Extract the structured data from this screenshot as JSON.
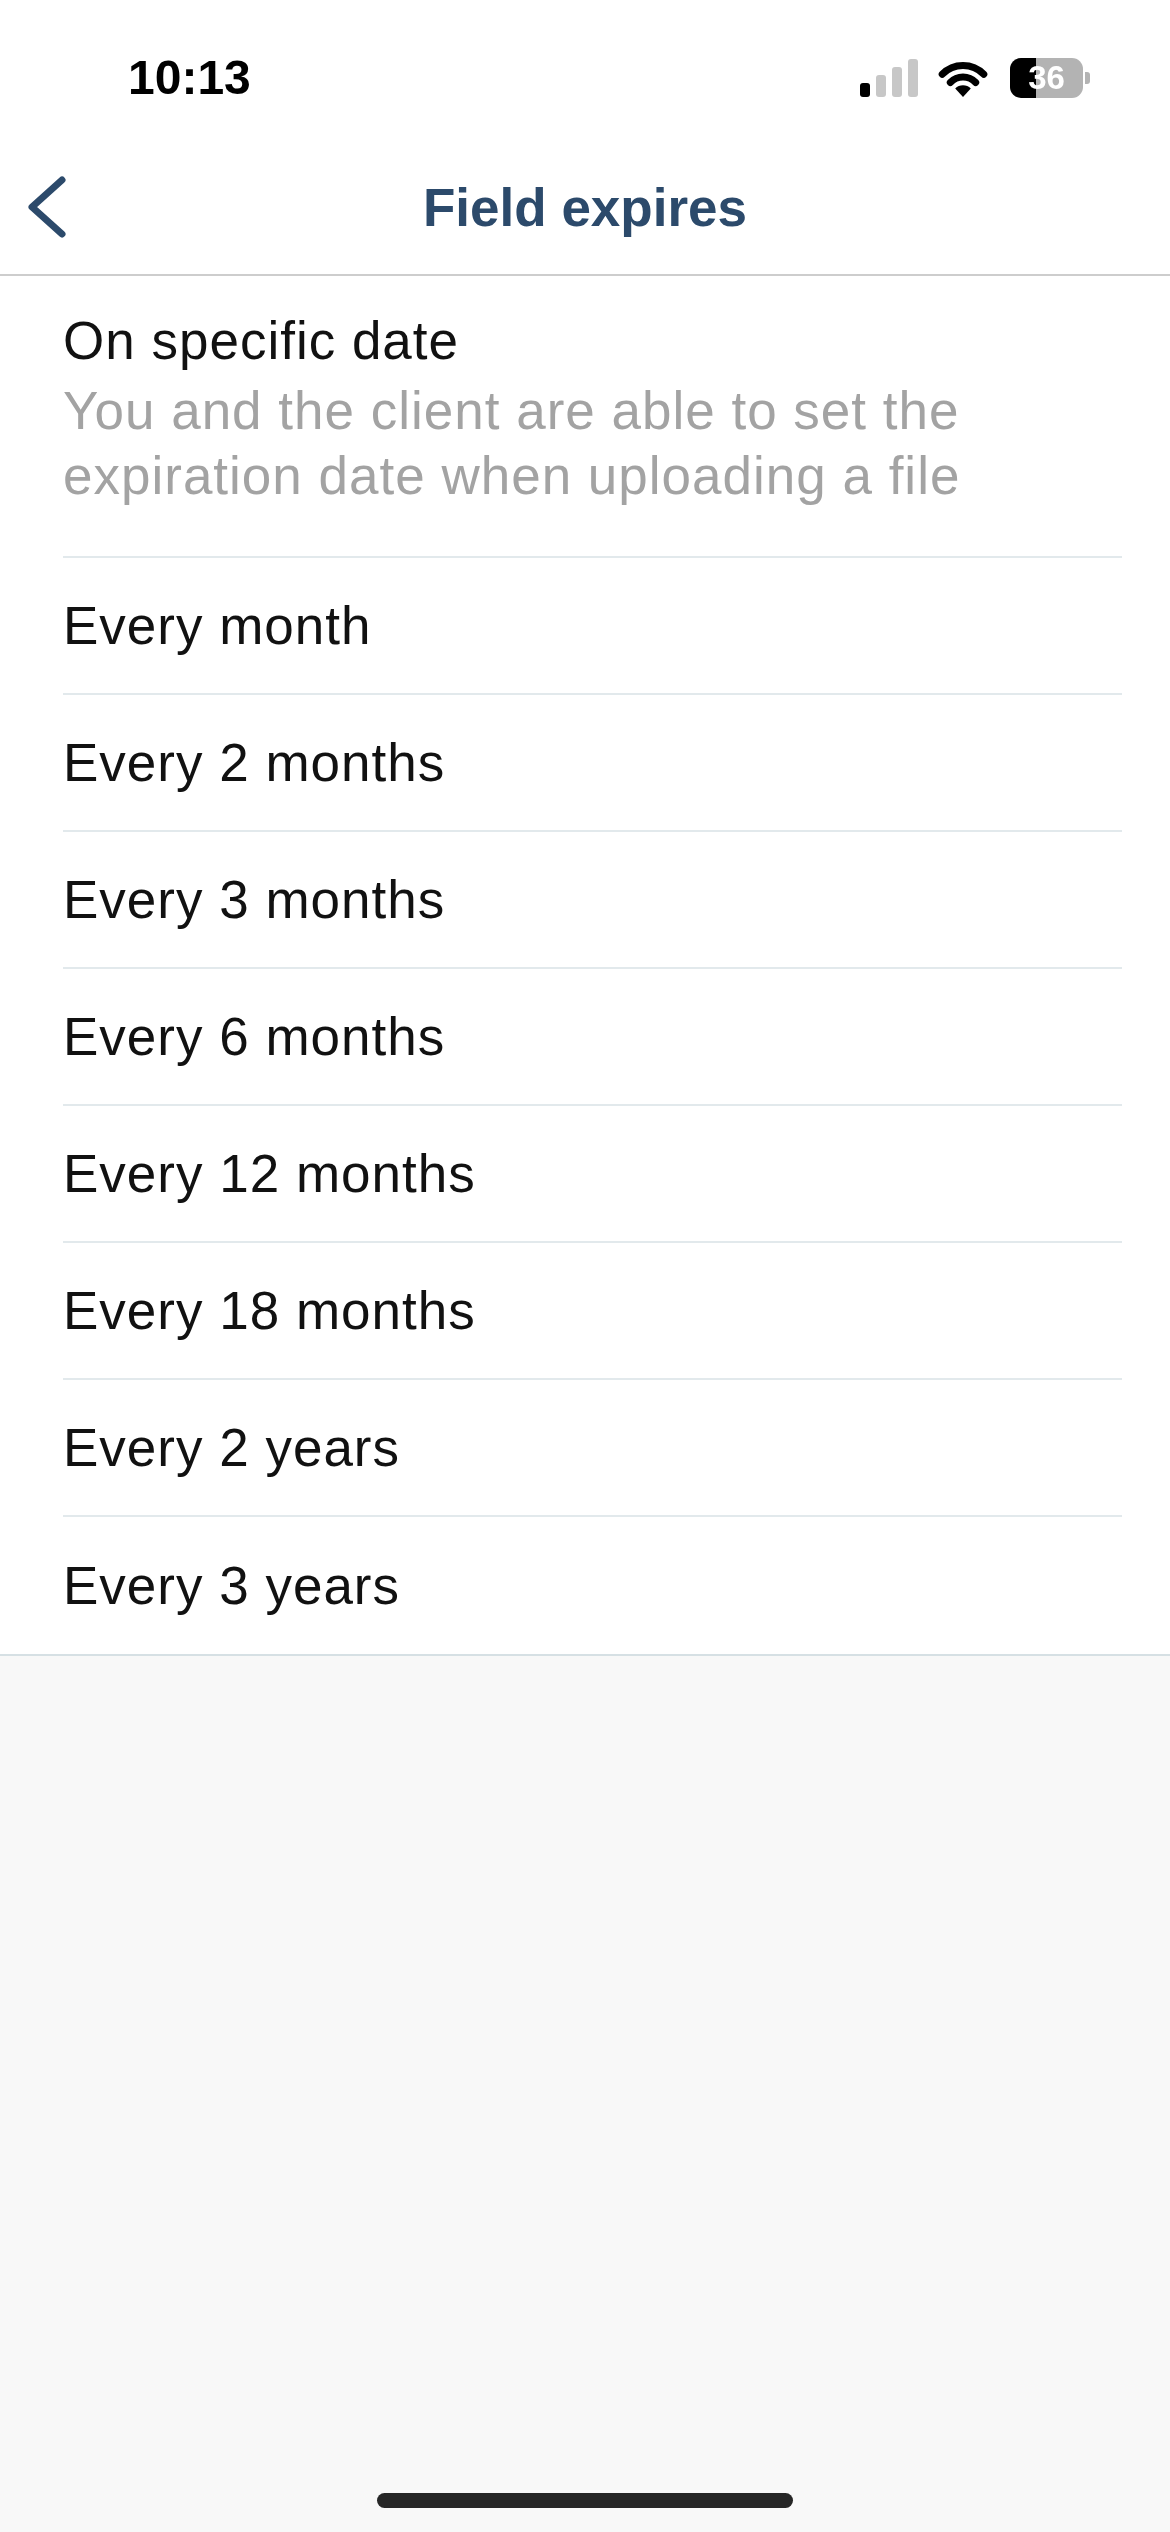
{
  "status_bar": {
    "time": "10:13",
    "battery": "36"
  },
  "nav_bar": {
    "title": "Field expires"
  },
  "options": [
    {
      "label": "On specific date",
      "description": "You and the client are able to set the expiration date when uploading a file"
    },
    {
      "label": "Every month"
    },
    {
      "label": "Every 2 months"
    },
    {
      "label": "Every 3 months"
    },
    {
      "label": "Every 6 months"
    },
    {
      "label": "Every 12 months"
    },
    {
      "label": "Every 18 months"
    },
    {
      "label": "Every 2 years"
    },
    {
      "label": "Every 3 years"
    }
  ]
}
